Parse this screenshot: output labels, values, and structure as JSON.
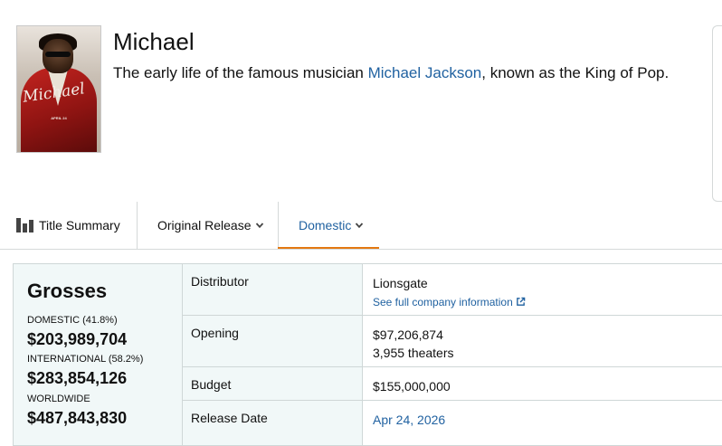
{
  "movie": {
    "title": "Michael",
    "synopsis_before": "The early life of the famous musician ",
    "synopsis_link": "Michael Jackson",
    "synopsis_after": ", known as the King of Pop."
  },
  "poster": {
    "title_script": "Michael",
    "date_text": "APRIL 24"
  },
  "tabs": [
    {
      "label": "Title Summary",
      "icon": "bar-chart-icon"
    },
    {
      "label": "Original Release",
      "icon": "chevron-down-icon"
    },
    {
      "label": "Domestic",
      "icon": "chevron-down-icon",
      "active": true
    }
  ],
  "grosses": {
    "heading": "Grosses",
    "domestic_label": "DOMESTIC (41.8%)",
    "domestic_value": "$203,989,704",
    "international_label": "INTERNATIONAL (58.2%)",
    "international_value": "$283,854,126",
    "worldwide_label": "WORLDWIDE",
    "worldwide_value": "$487,843,830"
  },
  "details": {
    "distributor_label": "Distributor",
    "distributor_value": "Lionsgate",
    "distributor_link": "See full company information",
    "opening_label": "Opening",
    "opening_value": "$97,206,874",
    "opening_theaters": "3,955 theaters",
    "budget_label": "Budget",
    "budget_value": "$155,000,000",
    "release_label": "Release Date",
    "release_value": "Apr 24, 2026"
  },
  "colors": {
    "link": "#2162a1",
    "active_tab_underline": "#e47911",
    "table_label_bg": "#f1f8f8"
  }
}
